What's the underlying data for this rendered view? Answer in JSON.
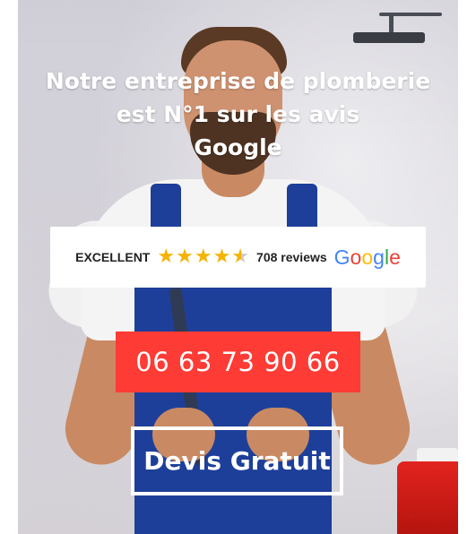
{
  "headline": {
    "line1": "Notre entreprise de plomberie",
    "line2": "est N°1 sur les avis",
    "line3": "Google"
  },
  "review_badge": {
    "rating_label": "EXCELLENT",
    "stars": 4.5,
    "reviews_count": "708 reviews",
    "brand": [
      "G",
      "o",
      "o",
      "g",
      "l",
      "e"
    ]
  },
  "cta": {
    "phone": "06 63 73 90 66",
    "quote": "Devis Gratuit"
  },
  "colors": {
    "phone_bg": "#ff3b35",
    "star": "#f4b400",
    "overalls": "#1d3f9a"
  }
}
